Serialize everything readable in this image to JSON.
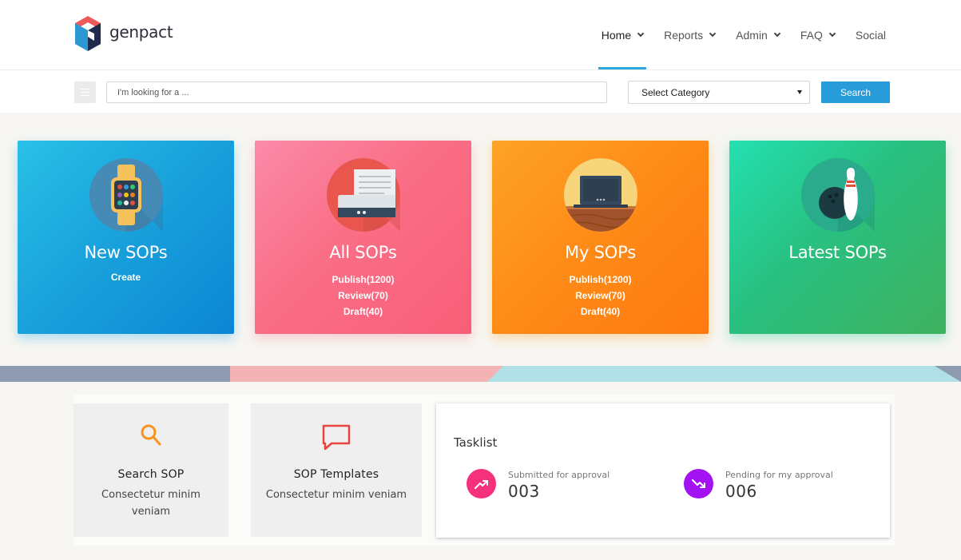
{
  "brand": {
    "name": "genpact"
  },
  "nav": {
    "items": [
      {
        "label": "Home",
        "has_dropdown": true,
        "active": true
      },
      {
        "label": "Reports",
        "has_dropdown": true,
        "active": false
      },
      {
        "label": "Admin",
        "has_dropdown": true,
        "active": false
      },
      {
        "label": "FAQ",
        "has_dropdown": true,
        "active": false
      },
      {
        "label": "Social",
        "has_dropdown": false,
        "active": false
      }
    ]
  },
  "search": {
    "placeholder": "I'm looking for a ...",
    "value": "",
    "category": "Select Category",
    "button": "Search"
  },
  "cards": [
    {
      "title": "New SOPs",
      "lines": [
        "Create"
      ],
      "icon": "smartwatch-icon"
    },
    {
      "title": "All SOPs",
      "lines": [
        "Publish(1200)",
        "Review(70)",
        "Draft(40)"
      ],
      "icon": "printer-icon"
    },
    {
      "title": "My SOPs",
      "lines": [
        "Publish(1200)",
        "Review(70)",
        "Draft(40)"
      ],
      "icon": "laptop-icon"
    },
    {
      "title": "Latest SOPs",
      "lines": [],
      "icon": "bowling-icon"
    }
  ],
  "tiles": [
    {
      "title": "Search SOP",
      "desc": "Consectetur minim veniam",
      "icon": "search-icon",
      "color": "#f7931e"
    },
    {
      "title": "SOP Templates",
      "desc": "Consectetur minim veniam",
      "icon": "chat-icon",
      "color": "#e8433d"
    }
  ],
  "tasklist": {
    "title": "Tasklist",
    "items": [
      {
        "label": "Submitted for approval",
        "value": "003",
        "icon": "trending-up-icon",
        "color": "#f5317b"
      },
      {
        "label": "Pending for my approval",
        "value": "006",
        "icon": "trending-down-icon",
        "color": "#a212f2"
      }
    ]
  },
  "colors": {
    "accent": "#279cd9",
    "card_blue": "#1aa3dc",
    "card_pink": "#fa6e86",
    "card_orange": "#fe8a17",
    "card_green": "#28c080"
  }
}
